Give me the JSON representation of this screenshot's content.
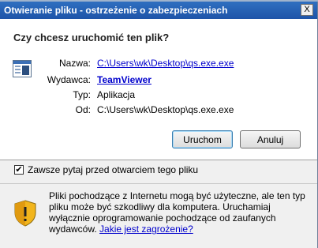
{
  "window": {
    "title": "Otwieranie pliku - ostrzeżenie o zabezpieczeniach",
    "close_glyph": "X"
  },
  "question": "Czy chcesz uruchomić ten plik?",
  "details": {
    "name_label": "Nazwa:",
    "name_value": "C:\\Users\\wk\\Desktop\\qs.exe.exe",
    "publisher_label": "Wydawca:",
    "publisher_value": "TeamViewer",
    "type_label": "Typ:",
    "type_value": "Aplikacja",
    "from_label": "Od:",
    "from_value": "C:\\Users\\wk\\Desktop\\qs.exe.exe"
  },
  "buttons": {
    "run": "Uruchom",
    "cancel": "Anuluj"
  },
  "checkbox": {
    "checked": true,
    "mark": "✔",
    "label": "Zawsze pytaj przed otwarciem tego pliku"
  },
  "warning": {
    "text": "Pliki pochodzące z Internetu mogą być użyteczne, ale ten typ pliku może być szkodliwy dla komputera. Uruchamiaj wyłącznie oprogramowanie pochodzące od zaufanych wydawców.",
    "link": "Jakie jest zagrożenie?"
  },
  "colors": {
    "title_bar": "#1e54a8",
    "link": "#0000cc",
    "shield": "#f2b51c"
  },
  "icons": {
    "file": "application-window-icon",
    "shield": "security-shield-icon"
  }
}
